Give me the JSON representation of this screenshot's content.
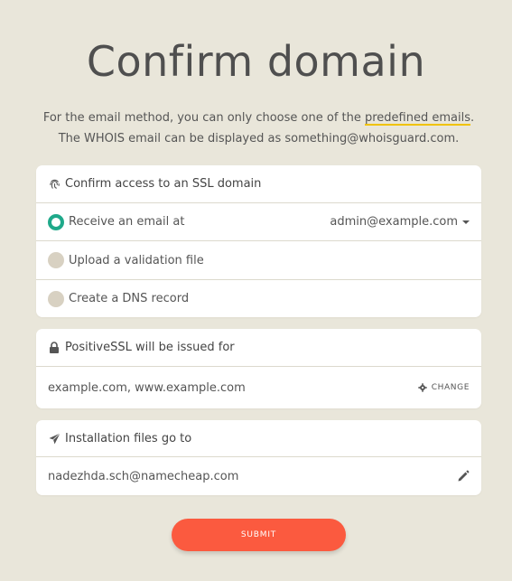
{
  "page": {
    "title": "Confirm domain",
    "subtitle": {
      "line1_before": "For the email method, you can only choose one of the ",
      "line1_link": "predefined emails",
      "line1_after": ".",
      "line2": "The WHOIS email can be displayed as something@whoisguard.com."
    }
  },
  "ssl_card": {
    "header_icon": "fingerprint-icon",
    "header": "Confirm access to an SSL domain",
    "options": [
      {
        "label": "Receive an email at",
        "selected": true
      },
      {
        "label": "Upload a validation file",
        "selected": false
      },
      {
        "label": "Create a DNS record",
        "selected": false
      }
    ],
    "email_value": "admin@example.com"
  },
  "issued_card": {
    "header_icon": "lock-icon",
    "header": "PositiveSSL will be issued for",
    "domains": "example.com, www.example.com",
    "change_label": "CHANGE",
    "change_icon": "gear-icon"
  },
  "install_card": {
    "header_icon": "paper-plane-icon",
    "header": "Installation files go to",
    "email": "nadezhda.sch@namecheap.com",
    "edit_icon": "pencil-icon"
  },
  "submit_label": "SUBMIT",
  "colors": {
    "background": "#e9e6da",
    "accent_green": "#1fa98a",
    "submit_red": "#fb5a3f",
    "underline_yellow": "#f0c300",
    "radio_unselected": "#d8d1c2"
  }
}
